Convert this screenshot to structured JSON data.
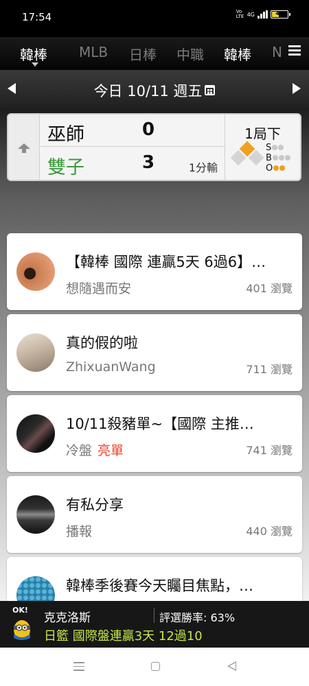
{
  "status_bar": {
    "time": "17:54",
    "network_label": "4G",
    "volte_label": "Vo LTE",
    "battery_level": "49"
  },
  "league_tabs": [
    {
      "label": "韓棒",
      "active": true
    },
    {
      "label": "MLB",
      "active": false
    },
    {
      "label": "日棒",
      "active": false
    },
    {
      "label": "中職",
      "active": false
    },
    {
      "label": "韓棒",
      "active": false
    },
    {
      "label": "N",
      "active": false
    }
  ],
  "date_bar": {
    "date_label": "今日 10/11 週五"
  },
  "game": {
    "away": {
      "name": "巫師",
      "score": "0"
    },
    "home": {
      "name": "雙子",
      "score": "3",
      "note": "1分輸"
    },
    "inning": "1局下",
    "count": {
      "s_label": "S",
      "b_label": "B",
      "o_label": "O",
      "strikes": 0,
      "balls": 0,
      "outs": 2
    }
  },
  "posts": [
    {
      "title": "【韓棒 國際 連贏5天 6過6】…",
      "author": "想隨遇而安",
      "tag": "",
      "views": "401 瀏覽"
    },
    {
      "title": "真的假的啦",
      "author": "ZhixuanWang",
      "tag": "",
      "views": "711 瀏覽"
    },
    {
      "title": "10/11殺豬單~【國際 主推…",
      "author": "冷盤",
      "tag": "亮單",
      "views": "741 瀏覽"
    },
    {
      "title": "有私分享",
      "author": "播報",
      "tag": "",
      "views": "440 瀏覽"
    },
    {
      "title": "韓棒季後賽今天矚目焦點，…",
      "author": "",
      "tag": "",
      "views": ""
    }
  ],
  "info_bar": {
    "mascot_text": "OK!",
    "name": "克克洛斯",
    "win_rate": "評選勝率: 63%",
    "pick": "日籃 國際盤連贏3天 12過10"
  },
  "colors": {
    "winner_green": "#3a9a3a",
    "tag_red": "#e8432a",
    "pick_green": "#c6e84a",
    "base_orange": "#f0a020"
  }
}
